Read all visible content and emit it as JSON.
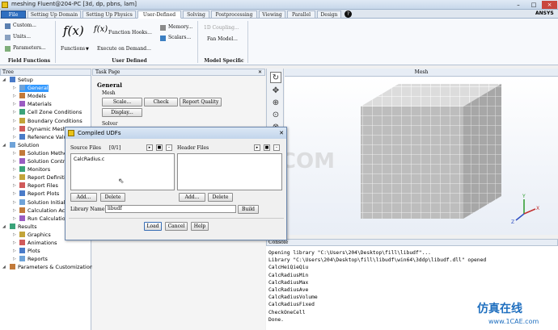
{
  "window": {
    "title": "meshing Fluent@204-PC  [3d, dp, pbns, lam]",
    "controls": [
      "–",
      "□",
      "×"
    ]
  },
  "menu": {
    "tabs": [
      "File",
      "Setting Up Domain",
      "Setting Up Physics",
      "User-Defined",
      "Solving",
      "Postprocessing",
      "Viewing",
      "Parallel",
      "Design"
    ],
    "active": "User-Defined",
    "brand": "ANSYS"
  },
  "ribbon": {
    "field_functions": {
      "group_label": "Field Functions",
      "custom": "Custom...",
      "units": "Units...",
      "parameters": "Parameters..."
    },
    "user_defined": {
      "group_label": "User Defined",
      "functions": "Functions",
      "function_hooks": "Function Hooks...",
      "memory": "Memory...",
      "scalars": "Scalars...",
      "execute_on_demand": "Execute on Demand...",
      "fx_symbol": "f(x)"
    },
    "model_specific": {
      "group_label": "Model Specific",
      "oneD_coupling": "1D Coupling...",
      "fan_model": "Fan Model..."
    }
  },
  "tree": {
    "header": "Tree",
    "items": [
      {
        "label": "Setup",
        "level": 0,
        "icon": "setup-icon"
      },
      {
        "label": "General",
        "level": 1,
        "selected": true,
        "icon": "general-icon"
      },
      {
        "label": "Models",
        "level": 1,
        "icon": "models-icon"
      },
      {
        "label": "Materials",
        "level": 1,
        "icon": "materials-icon"
      },
      {
        "label": "Cell Zone Conditions",
        "level": 1,
        "icon": "cell-zone-icon"
      },
      {
        "label": "Boundary Conditions",
        "level": 1,
        "icon": "boundary-icon"
      },
      {
        "label": "Dynamic Mesh",
        "level": 1,
        "icon": "dynamic-mesh-icon"
      },
      {
        "label": "Reference Values",
        "level": 1,
        "icon": "reference-icon"
      },
      {
        "label": "Solution",
        "level": 0,
        "icon": "solution-icon"
      },
      {
        "label": "Solution Methods",
        "level": 1,
        "icon": "methods-icon"
      },
      {
        "label": "Solution Controls",
        "level": 1,
        "icon": "controls-icon"
      },
      {
        "label": "Monitors",
        "level": 1,
        "icon": "monitors-icon"
      },
      {
        "label": "Report Definitions",
        "level": 1,
        "icon": "report-def-icon"
      },
      {
        "label": "Report Files",
        "level": 1,
        "icon": "report-files-icon"
      },
      {
        "label": "Report Plots",
        "level": 1,
        "icon": "report-plots-icon"
      },
      {
        "label": "Solution Initialization",
        "level": 1,
        "icon": "init-icon"
      },
      {
        "label": "Calculation Activities",
        "level": 1,
        "icon": "activities-icon"
      },
      {
        "label": "Run Calculation",
        "level": 1,
        "icon": "run-icon"
      },
      {
        "label": "Results",
        "level": 0,
        "icon": "results-icon"
      },
      {
        "label": "Graphics",
        "level": 1,
        "icon": "graphics-icon"
      },
      {
        "label": "Animations",
        "level": 1,
        "icon": "animations-icon"
      },
      {
        "label": "Plots",
        "level": 1,
        "icon": "plots-icon"
      },
      {
        "label": "Reports",
        "level": 1,
        "icon": "reports-icon"
      },
      {
        "label": "Parameters & Customization",
        "level": 0,
        "icon": "parameters-icon"
      }
    ]
  },
  "task_page": {
    "header": "Task Page",
    "title": "General",
    "mesh_label": "Mesh",
    "scale": "Scale...",
    "check": "Check",
    "report_quality": "Report Quality",
    "display": "Display...",
    "solver": "Solver"
  },
  "mesh_view": {
    "header": "Mesh"
  },
  "console": {
    "header": "Console",
    "lines": [
      "Opening library \"C:\\Users\\204\\Desktop\\fill\\libudf\"...",
      "Library \"C:\\Users\\204\\Desktop\\fill\\libudf\\win64\\3ddp\\libudf.dll\" opened",
      "      CalcHeiQieQiu",
      "      CalcRadiusMin",
      "      CalcRadiusMax",
      "      CalcRadiusAve",
      "      CalcRadiusVolume",
      "      CalcRadiusFixed",
      "      CheckOneCell",
      "Done."
    ]
  },
  "dialog": {
    "title": "Compiled UDFs",
    "source_files": {
      "label": "Source Files",
      "count": "[0/1]",
      "items": [
        "CalcRadius.c"
      ]
    },
    "header_files": {
      "label": "Header Files",
      "items": []
    },
    "add": "Add...",
    "delete": "Delete",
    "library_name_label": "Library Name",
    "library_name_value": "libudf",
    "build": "Build",
    "load": "Load",
    "cancel": "Cancel",
    "help": "Help"
  },
  "watermark": {
    "center": "1CAE.COM",
    "corner_cn": "仿真在线",
    "corner_url": "www.1CAE.com"
  },
  "colors": {
    "selection": "#3399ff",
    "file_tab": "#2f6fc0",
    "cube_top": "#d7d7d7",
    "cube_front": "#bdbdbd",
    "cube_side": "#a3a3a3"
  }
}
